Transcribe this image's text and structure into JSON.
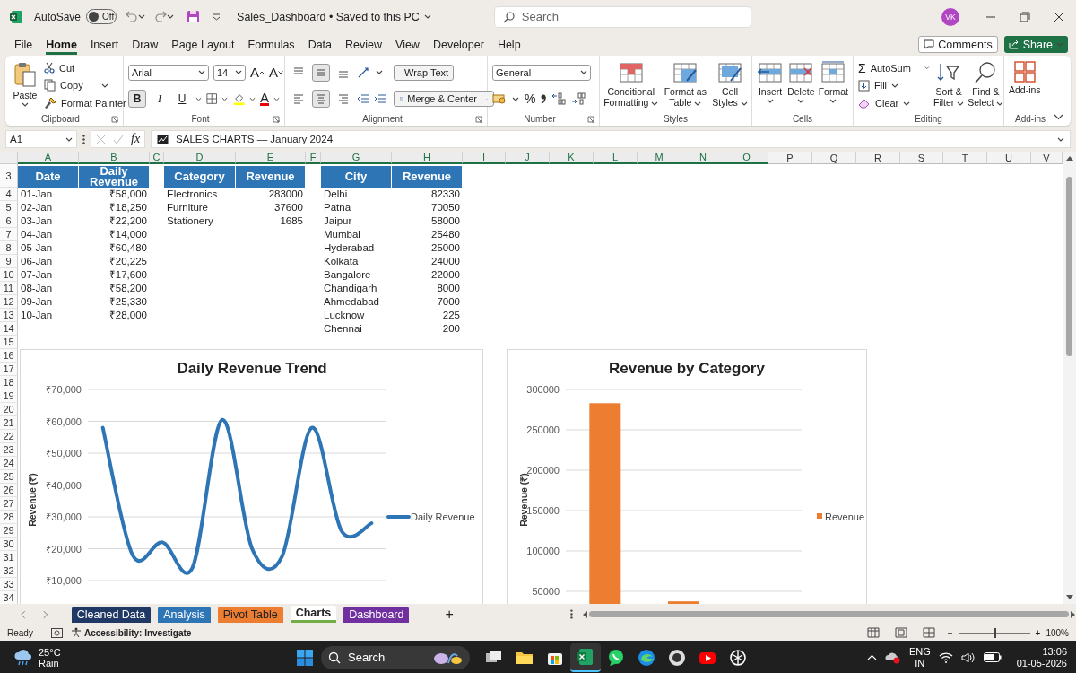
{
  "title_bar": {
    "autosave_label": "AutoSave",
    "autosave": {
      "label": "Off",
      "on": false
    },
    "document_title": "Sales_Dashboard • Saved to this PC",
    "search": {
      "placeholder": "Search"
    },
    "avatar": "VK"
  },
  "menu": [
    {
      "label": "File",
      "selected": false
    },
    {
      "label": "Home",
      "selected": true
    },
    {
      "label": "Insert",
      "selected": false
    },
    {
      "label": "Draw",
      "selected": false
    },
    {
      "label": "Page Layout",
      "selected": false
    },
    {
      "label": "Formulas",
      "selected": false
    },
    {
      "label": "Data",
      "selected": false
    },
    {
      "label": "Review",
      "selected": false
    },
    {
      "label": "View",
      "selected": false
    },
    {
      "label": "Developer",
      "selected": false
    },
    {
      "label": "Help",
      "selected": false
    }
  ],
  "actions": {
    "comments": "Comments",
    "share": "Share"
  },
  "ribbon": {
    "clipboard": {
      "label": "Clipboard",
      "paste": "Paste",
      "cut": "Cut",
      "copy": "Copy",
      "painter": "Format Painter"
    },
    "font": {
      "label": "Font",
      "family": "Arial",
      "size": "14",
      "grow": "A",
      "shrink": "A",
      "color_letter": "A",
      "styles": [
        {
          "label": "B",
          "selected": true
        },
        {
          "label": "I",
          "selected": false
        },
        {
          "label": "U",
          "selected": false
        }
      ]
    },
    "alignment": {
      "label": "Alignment",
      "vertical": [
        {
          "selected": false
        },
        {
          "selected": true
        },
        {
          "selected": false
        }
      ],
      "horizontal": [
        {
          "selected": false
        },
        {
          "selected": true
        },
        {
          "selected": false
        }
      ],
      "wrap_text": "Wrap Text",
      "merge": "Merge & Center"
    },
    "number": {
      "label": "Number",
      "format": "General",
      "percent": "%"
    },
    "styles": {
      "label": "Styles",
      "items": [
        {
          "kind": "conditional",
          "lines": [
            "Conditional",
            "Formatting"
          ]
        },
        {
          "kind": "table",
          "lines": [
            "Format as",
            "Table"
          ]
        },
        {
          "kind": "cellstyles",
          "lines": [
            "Cell",
            "Styles"
          ]
        }
      ]
    },
    "cells": {
      "label": "Cells",
      "items": [
        {
          "kind": "insert",
          "label": "Insert"
        },
        {
          "kind": "delete",
          "label": "Delete"
        },
        {
          "kind": "format",
          "label": "Format"
        }
      ]
    },
    "editing": {
      "label": "Editing",
      "sigma": "Σ",
      "autosum": "AutoSum",
      "fill": "Fill",
      "clear": "Clear",
      "sort": [
        "Sort &",
        "Filter"
      ],
      "find": [
        "Find &",
        "Select"
      ]
    },
    "addins": {
      "label": "Add-ins",
      "button": "Add-ins"
    }
  },
  "formula_bar": {
    "name_box": "A1",
    "fx": "fx",
    "content": "SALES CHARTS — January 2024"
  },
  "sheet": {
    "columns": [
      {
        "label": "A",
        "selected": true
      },
      {
        "label": "B",
        "selected": true
      },
      {
        "label": "C",
        "selected": true
      },
      {
        "label": "D",
        "selected": true
      },
      {
        "label": "E",
        "selected": true
      },
      {
        "label": "F",
        "selected": true
      },
      {
        "label": "G",
        "selected": true
      },
      {
        "label": "H",
        "selected": true
      },
      {
        "label": "I",
        "selected": true
      },
      {
        "label": "J",
        "selected": true
      },
      {
        "label": "K",
        "selected": true
      },
      {
        "label": "L",
        "selected": true
      },
      {
        "label": "M",
        "selected": true
      },
      {
        "label": "N",
        "selected": true
      },
      {
        "label": "O",
        "selected": true
      },
      {
        "label": "P",
        "selected": false
      },
      {
        "label": "Q",
        "selected": false
      },
      {
        "label": "R",
        "selected": false
      },
      {
        "label": "S",
        "selected": false
      },
      {
        "label": "T",
        "selected": false
      },
      {
        "label": "U",
        "selected": false
      },
      {
        "label": "V",
        "selected": false
      }
    ],
    "rows": [
      "3",
      "4",
      "5",
      "6",
      "7",
      "8",
      "9",
      "10",
      "11",
      "12",
      "13",
      "14",
      "15",
      "16",
      "17",
      "18",
      "19",
      "20",
      "21",
      "22",
      "23",
      "24",
      "25",
      "26",
      "27",
      "28",
      "29",
      "30",
      "31",
      "32",
      "33",
      "34"
    ],
    "tables": [
      {
        "headers": [
          "Date",
          "Daily Revenue"
        ],
        "rows": [
          [
            "01-Jan",
            "₹58,000"
          ],
          [
            "02-Jan",
            "₹18,250"
          ],
          [
            "03-Jan",
            "₹22,200"
          ],
          [
            "04-Jan",
            "₹14,000"
          ],
          [
            "05-Jan",
            "₹60,480"
          ],
          [
            "06-Jan",
            "₹20,225"
          ],
          [
            "07-Jan",
            "₹17,600"
          ],
          [
            "08-Jan",
            "₹58,200"
          ],
          [
            "09-Jan",
            "₹25,330"
          ],
          [
            "10-Jan",
            "₹28,000"
          ]
        ]
      },
      {
        "headers": [
          "Category",
          "Revenue"
        ],
        "rows": [
          [
            "Electronics",
            "283000"
          ],
          [
            "Furniture",
            "37600"
          ],
          [
            "Stationery",
            "1685"
          ]
        ]
      },
      {
        "headers": [
          "City",
          "Revenue"
        ],
        "rows": [
          [
            "Delhi",
            "82330"
          ],
          [
            "Patna",
            "70050"
          ],
          [
            "Jaipur",
            "58000"
          ],
          [
            "Mumbai",
            "25480"
          ],
          [
            "Hyderabad",
            "25000"
          ],
          [
            "Kolkata",
            "24000"
          ],
          [
            "Bangalore",
            "22000"
          ],
          [
            "Chandigarh",
            "8000"
          ],
          [
            "Ahmedabad",
            "7000"
          ],
          [
            "Lucknow",
            "225"
          ],
          [
            "Chennai",
            "200"
          ]
        ]
      }
    ]
  },
  "charts": [
    {
      "chart_data": {
        "type": "line",
        "title": "Daily Revenue Trend",
        "ylabel": "Revenue (₹)",
        "grid": true,
        "ylim": [
          10000,
          70000
        ],
        "yticks": [
          {
            "value": 10000,
            "label": "₹10,000"
          },
          {
            "value": 20000,
            "label": "₹20,000"
          },
          {
            "value": 30000,
            "label": "₹30,000"
          },
          {
            "value": 40000,
            "label": "₹40,000"
          },
          {
            "value": 50000,
            "label": "₹50,000"
          },
          {
            "value": 60000,
            "label": "₹60,000"
          },
          {
            "value": 70000,
            "label": "₹70,000"
          }
        ],
        "series": [
          {
            "name": "Daily Revenue",
            "color": "#2e75b6",
            "values": [
              58000,
              18000,
              22000,
              14000,
              60500,
              20000,
              17500,
              58000,
              25500,
              28000
            ]
          }
        ]
      }
    },
    {
      "chart_data": {
        "type": "bar",
        "title": "Revenue by Category",
        "ylabel": "Revenue (₹)",
        "grid": true,
        "ylim": [
          0,
          300000
        ],
        "yticks": [
          50000,
          100000,
          150000,
          200000,
          250000,
          300000
        ],
        "series": [
          {
            "name": "Revenue",
            "color": "#ed7d31",
            "values": [
              283000,
              37600
            ]
          }
        ]
      }
    }
  ],
  "sheet_tabs": [
    {
      "label": "Cleaned Data",
      "color": "#1f3864",
      "selected": false
    },
    {
      "label": "Analysis",
      "color": "#2e75b6",
      "selected": false
    },
    {
      "label": "Pivot Table",
      "color": "#ed7d31",
      "selected": false
    },
    {
      "label": "Charts",
      "color": "#70ad47",
      "selected": true
    },
    {
      "label": "Dashboard",
      "color": "#7030a0",
      "selected": false
    }
  ],
  "new_sheet": "+",
  "status_bar": {
    "ready": "Ready",
    "accessibility": "Accessibility: Investigate",
    "zoom": {
      "minus": "−",
      "plus": "+",
      "level": 0.5,
      "reading": "100%"
    }
  },
  "taskbar": {
    "weather": {
      "temp": "25°C",
      "condition": "Rain"
    },
    "search": "Search",
    "apps": [
      {
        "kind": "taskview",
        "active": false
      },
      {
        "kind": "folder",
        "active": false
      },
      {
        "kind": "store",
        "active": false
      },
      {
        "kind": "sheet",
        "active": true
      },
      {
        "kind": "chat",
        "active": false
      },
      {
        "kind": "browser",
        "active": false
      },
      {
        "kind": "circle",
        "active": false
      },
      {
        "kind": "video",
        "active": false
      },
      {
        "kind": "knot",
        "active": false
      }
    ],
    "language": [
      "ENG",
      "IN"
    ],
    "time": "13:06",
    "date": "01-05-2026"
  }
}
